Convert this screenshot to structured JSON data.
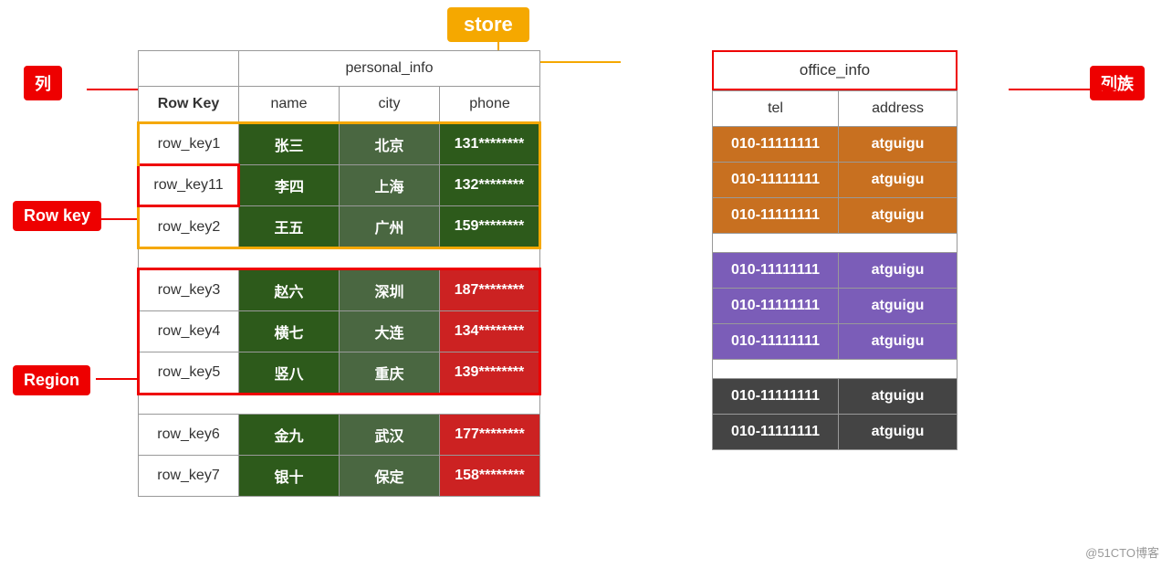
{
  "store": {
    "label": "store"
  },
  "labels": {
    "lie": "列",
    "rowkey": "Row key",
    "region": "Region",
    "liezu": "列族"
  },
  "personal_info_header": "personal_info",
  "office_info_header": "office_info",
  "columns": {
    "row_key": "Row Key",
    "name": "name",
    "city": "city",
    "phone": "phone",
    "tel": "tel",
    "address": "address"
  },
  "rows": [
    {
      "key": "row_key1",
      "name": "张三",
      "city": "北京",
      "phone": "131********",
      "tel": "010-11111111",
      "address": "atguigu"
    },
    {
      "key": "row_key11",
      "name": "李四",
      "city": "上海",
      "phone": "132********",
      "tel": "010-11111111",
      "address": "atguigu"
    },
    {
      "key": "row_key2",
      "name": "王五",
      "city": "广州",
      "phone": "159********",
      "tel": "010-11111111",
      "address": "atguigu"
    },
    {
      "key": "row_key3",
      "name": "赵六",
      "city": "深圳",
      "phone": "187********",
      "tel": "010-11111111",
      "address": "atguigu"
    },
    {
      "key": "row_key4",
      "name": "横七",
      "city": "大连",
      "phone": "134********",
      "tel": "010-11111111",
      "address": "atguigu"
    },
    {
      "key": "row_key5",
      "name": "竖八",
      "city": "重庆",
      "phone": "139********",
      "tel": "010-11111111",
      "address": "atguigu"
    },
    {
      "key": "row_key6",
      "name": "金九",
      "city": "武汉",
      "phone": "177********",
      "tel": "010-11111111",
      "address": "atguigu"
    },
    {
      "key": "row_key7",
      "name": "银十",
      "city": "保定",
      "phone": "158********",
      "tel": "010-11111111",
      "address": "atguigu"
    }
  ],
  "watermark": "@51CTO博客"
}
